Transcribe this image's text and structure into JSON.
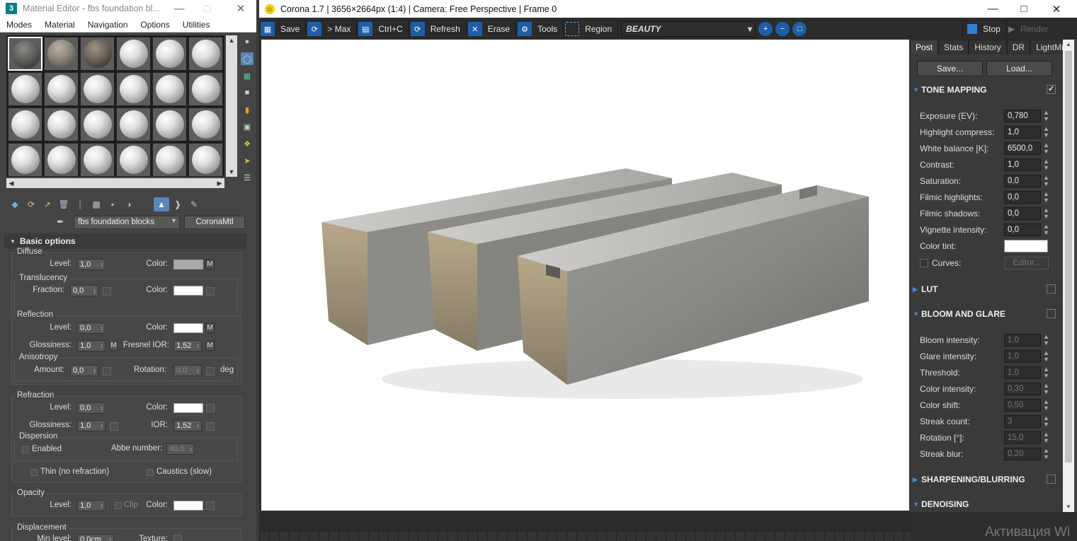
{
  "material_editor": {
    "title": "Material Editor - fbs foundation bl...",
    "menu": [
      "Modes",
      "Material",
      "Navigation",
      "Options",
      "Utilities"
    ],
    "material_name": "fbs foundation blocks",
    "material_type": "CoronaMtl",
    "basic_options_header": "Basic options",
    "diffuse": {
      "title": "Diffuse",
      "level_label": "Level:",
      "level": "1,0",
      "color_label": "Color:",
      "color": "#a8a8a8",
      "map": "M"
    },
    "translucency": {
      "title": "Translucency",
      "fraction_label": "Fraction:",
      "fraction": "0,0",
      "color_label": "Color:",
      "color": "#ffffff"
    },
    "reflection": {
      "title": "Reflection",
      "level_label": "Level:",
      "level": "0,0",
      "color_label": "Color:",
      "color": "#ffffff",
      "map": "M",
      "glossiness_label": "Glossiness:",
      "glossiness": "1,0",
      "gloss_map": "M",
      "fresnel_label": "Fresnel IOR:",
      "fresnel": "1,52",
      "fresnel_map": "M"
    },
    "anisotropy": {
      "title": "Anisotropy",
      "amount_label": "Amount:",
      "amount": "0,0",
      "rotation_label": "Rotation:",
      "rotation": "0,0",
      "unit": "deg"
    },
    "refraction": {
      "title": "Refraction",
      "level_label": "Level:",
      "level": "0,0",
      "color_label": "Color:",
      "color": "#ffffff",
      "glossiness_label": "Glossiness:",
      "glossiness": "1,0",
      "ior_label": "IOR:",
      "ior": "1,52"
    },
    "dispersion": {
      "title": "Dispersion",
      "enabled_label": "Enabled",
      "abbe_label": "Abbe number:",
      "abbe": "40,0"
    },
    "thin_label": "Thin (no refraction)",
    "caustics_label": "Caustics (slow)",
    "opacity": {
      "title": "Opacity",
      "level_label": "Level:",
      "level": "1,0",
      "clip_label": "Clip",
      "color_label": "Color:",
      "color": "#ffffff"
    },
    "displacement": {
      "title": "Displacement",
      "min_label": "Min level:",
      "min": "0,0cm",
      "texture_label": "Texture:"
    }
  },
  "corona": {
    "title": "Corona 1.7 | 3656×2664px (1:4) | Camera: Free Perspective | Frame 0",
    "toolbar": {
      "save": "Save",
      "to_max": "> Max",
      "copy": "Ctrl+C",
      "refresh": "Refresh",
      "erase": "Erase",
      "tools": "Tools",
      "region": "Region",
      "pass": "BEAUTY",
      "stop": "Stop",
      "render": "Render"
    },
    "tabs": [
      "Post",
      "Stats",
      "History",
      "DR",
      "LightMix"
    ],
    "save_btn": "Save...",
    "load_btn": "Load...",
    "tone_mapping": {
      "title": "TONE MAPPING",
      "exposure_label": "Exposure (EV):",
      "exposure": "0,780",
      "highlight_label": "Highlight compress:",
      "highlight": "1,0",
      "white_balance_label": "White balance [K]:",
      "white_balance": "6500,0",
      "contrast_label": "Contrast:",
      "contrast": "1,0",
      "saturation_label": "Saturation:",
      "saturation": "0,0",
      "filmic_highlights_label": "Filmic highlights:",
      "filmic_highlights": "0,0",
      "filmic_shadows_label": "Filmic shadows:",
      "filmic_shadows": "0,0",
      "vignette_label": "Vignette intensity:",
      "vignette": "0,0",
      "color_tint_label": "Color tint:",
      "curves_label": "Curves:",
      "editor_btn": "Editor..."
    },
    "lut": {
      "title": "LUT"
    },
    "bloom_glare": {
      "title": "BLOOM AND GLARE",
      "bloom_label": "Bloom intensity:",
      "bloom": "1,0",
      "glare_label": "Glare intensity:",
      "glare": "1,0",
      "threshold_label": "Threshold:",
      "threshold": "1,0",
      "color_intensity_label": "Color intensity:",
      "color_intensity": "0,30",
      "color_shift_label": "Color shift:",
      "color_shift": "0,50",
      "streak_count_label": "Streak count:",
      "streak_count": "3",
      "rotation_label": "Rotation [°]:",
      "rotation": "15,0",
      "streak_blur_label": "Streak blur:",
      "streak_blur": "0,20"
    },
    "sharpening": {
      "title": "SHARPENING/BLURRING"
    },
    "denoising": {
      "title": "DENOISING"
    }
  },
  "overlay_text": "Активация Wi",
  "colors": {
    "accent": "#1e5ea8",
    "tri_blue": "#3c8be0",
    "panel": "#3a3a3a"
  }
}
